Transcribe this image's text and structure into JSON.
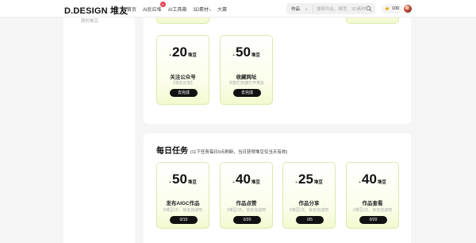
{
  "header": {
    "logo": "D.DESIGN 堆友",
    "nav": [
      {
        "label": "首页",
        "has_chevron": false,
        "badge": ""
      },
      {
        "label": "AI反应堆",
        "has_chevron": false,
        "badge": "N"
      },
      {
        "label": "AI工具箱",
        "has_chevron": false,
        "badge": ""
      },
      {
        "label": "3D素材",
        "has_chevron": true,
        "badge": ""
      },
      {
        "label": "大赛",
        "has_chevron": false,
        "badge": ""
      }
    ],
    "search": {
      "category": "作品",
      "placeholder": "搜索作品、模型、3D素材"
    },
    "coins": "100"
  },
  "sidebar": {
    "item": "我的堆豆"
  },
  "top_section": {
    "cards": [
      {
        "plus": "+",
        "amount": "20",
        "unit": "堆豆",
        "title": "关注公众号",
        "sub": "【堆友创意】",
        "button": "去完成"
      },
      {
        "plus": "+",
        "amount": "50",
        "unit": "堆豆",
        "title": "收藏网址",
        "sub": "书签栏快捷打开堆友",
        "button": "去完成"
      }
    ]
  },
  "daily": {
    "title": "每日任务",
    "note": "(以下任务每日0点刷新，当日获得堆豆仅当天有效)",
    "cards": [
      {
        "plus": "+",
        "amount": "50",
        "unit": "堆豆",
        "title": "发布AIGC作品",
        "sub": "5堆豆/次，快去完成吧",
        "button": "0/10"
      },
      {
        "plus": "+",
        "amount": "40",
        "unit": "堆豆",
        "title": "作品点赞",
        "sub": "2堆豆/次，快去完成吧",
        "button": "0/20"
      },
      {
        "plus": "+",
        "amount": "25",
        "unit": "堆豆",
        "title": "作品分享",
        "sub": "5堆豆/次，快去完成吧",
        "button": "0/5"
      },
      {
        "plus": "+",
        "amount": "40",
        "unit": "堆豆",
        "title": "作品查看",
        "sub": "2堆豆/次，快去完成吧",
        "button": "0/20"
      }
    ]
  }
}
